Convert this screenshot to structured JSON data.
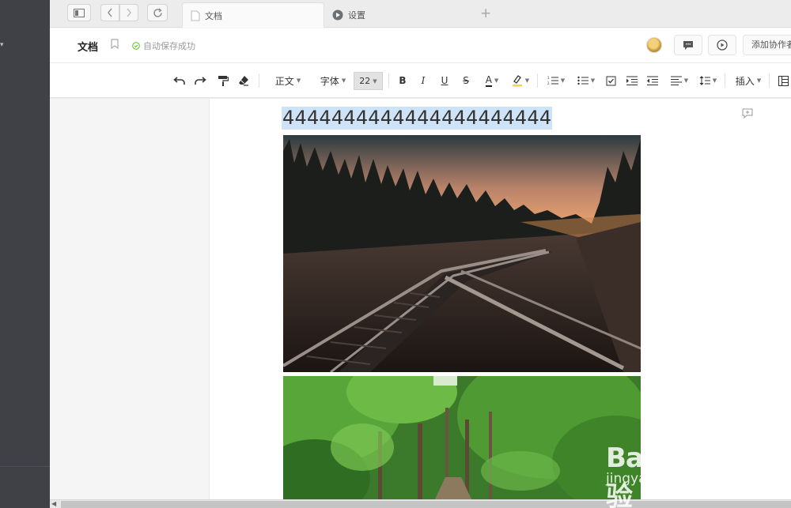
{
  "tabs": [
    {
      "label": "文档",
      "icon": "document-icon",
      "active": true
    },
    {
      "label": "设置",
      "icon": "settings-icon",
      "active": false
    }
  ],
  "new_tab_symbol": "+",
  "titlebar": {
    "doc_title": "文档",
    "autosave_status": "自动保存成功",
    "add_collaborator": "添加协作者"
  },
  "toolbar": {
    "paragraph_style": "正文",
    "font": "字体",
    "font_size": "22",
    "bold": "B",
    "italic": "I",
    "underline": "U",
    "strike": "S",
    "text_color": "A",
    "insert": "插入"
  },
  "document": {
    "heading": "4444444444444444444444"
  },
  "watermark": {
    "brand": "Bai du 经验",
    "site": "jingyan.baidu.com"
  },
  "colors": {
    "sidebar": "#3f4147",
    "selection": "#cfe3f8",
    "accent_green": "#52c41a",
    "highlight_yellow": "#f5d742"
  }
}
